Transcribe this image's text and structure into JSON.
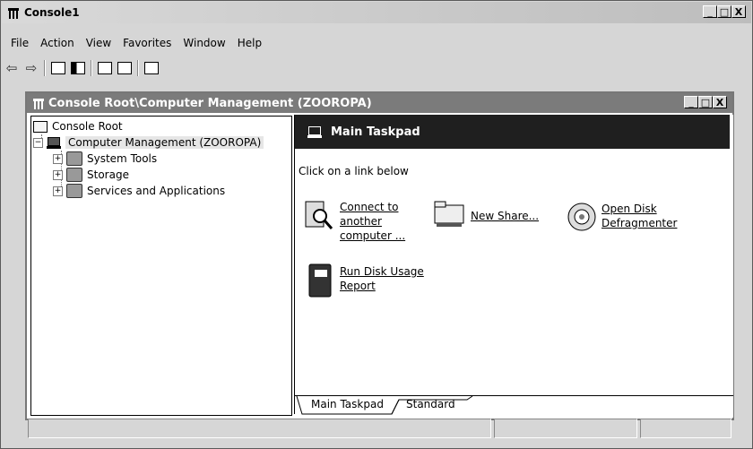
{
  "app": {
    "title": "Console1"
  },
  "window_buttons": {
    "minimize": "_",
    "maximize": "□",
    "close": "X"
  },
  "menu": [
    "File",
    "Action",
    "View",
    "Favorites",
    "Window",
    "Help"
  ],
  "toolbar": {
    "back": "⇦",
    "forward": "⇨"
  },
  "mdi": {
    "title": "Console Root\\Computer Management (ZOOROPA)"
  },
  "tree": {
    "root": "Console Root",
    "computer": "Computer Management (ZOOROPA)",
    "children": [
      "System Tools",
      "Storage",
      "Services and Applications"
    ],
    "expander": "+",
    "collapse": "−"
  },
  "taskpad": {
    "header": "Main Taskpad",
    "instruction": "Click on a link below",
    "tasks": [
      {
        "icon": "search-computer-icon",
        "lines": [
          "Connect to",
          "another",
          "computer ..."
        ]
      },
      {
        "icon": "share-folder-icon",
        "lines": [
          "New Share..."
        ]
      },
      {
        "icon": "disc-icon",
        "lines": [
          "Open Disk",
          "Defragmenter"
        ]
      },
      {
        "icon": "book-icon",
        "lines": [
          "Run Disk Usage",
          "Report"
        ]
      }
    ],
    "tabs": [
      "Main Taskpad",
      "Standard"
    ]
  }
}
